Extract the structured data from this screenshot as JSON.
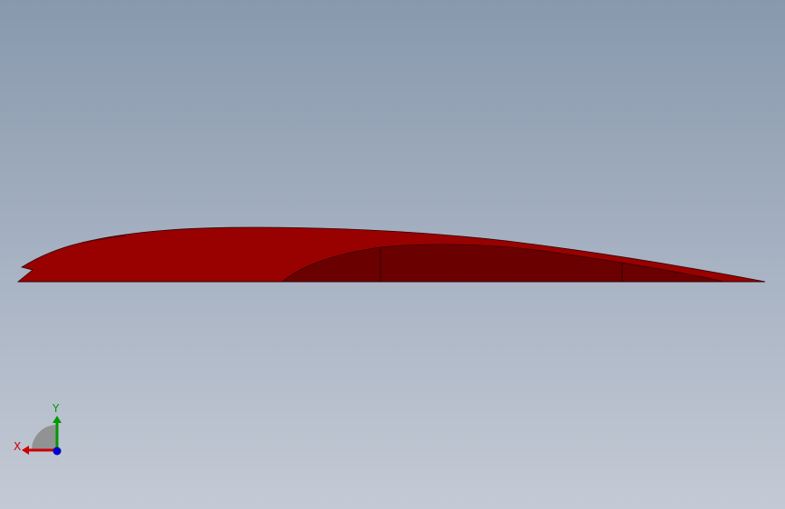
{
  "viewport": {
    "background_top": "#8898ad",
    "background_bottom": "#c4cad5"
  },
  "model": {
    "name": "airfoil-wing-section",
    "upper_surface_color": "#990000",
    "lower_surface_color": "#6b0000",
    "edge_color": "#330000"
  },
  "triad": {
    "x_label": "X",
    "y_label": "Y",
    "x_color": "#cc0000",
    "y_color": "#009900",
    "z_color": "#0000cc"
  }
}
